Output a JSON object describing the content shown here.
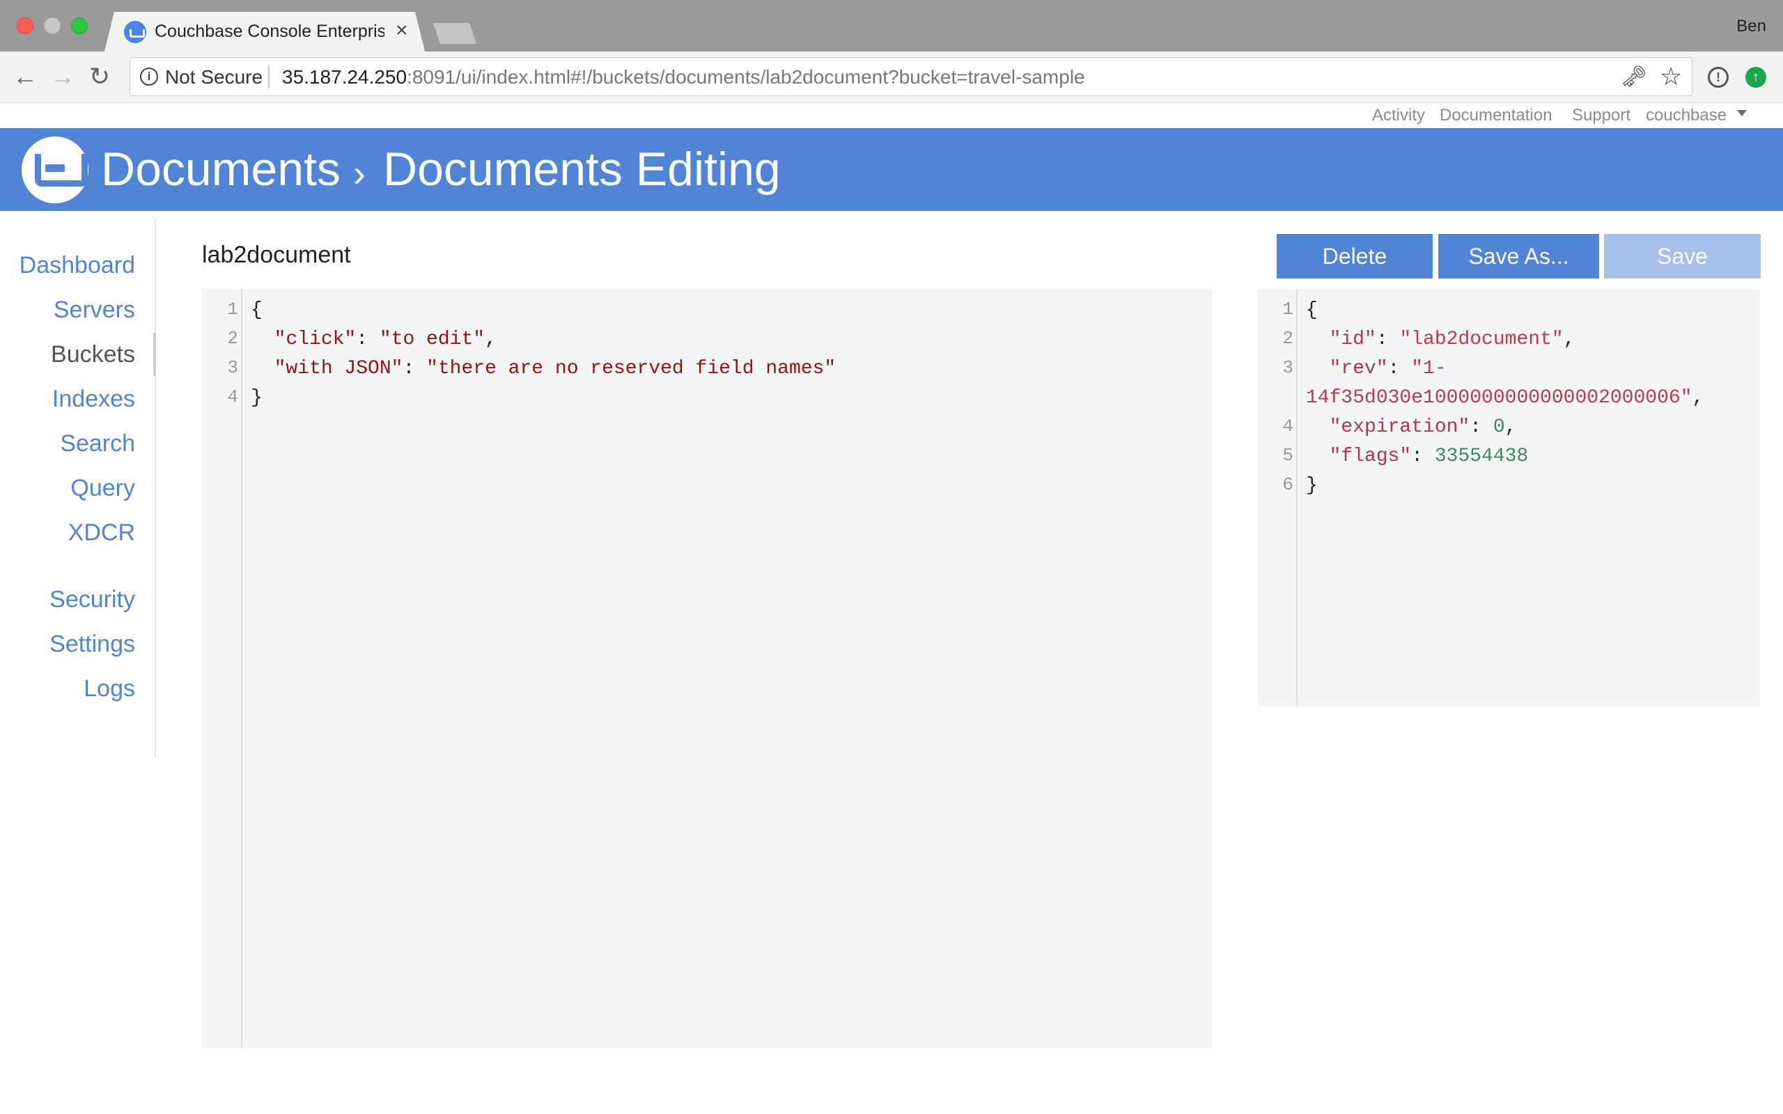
{
  "browser": {
    "tab_title": "Couchbase Console Enterprise Edition",
    "tab_close": "×",
    "profile_name": "Ben",
    "security_label": "Not Secure",
    "url_host": "35.187.24.250",
    "url_rest": ":8091/ui/index.html#!/buckets/documents/lab2document?bucket=travel-sample",
    "icons": [
      "back-arrow-icon",
      "forward-arrow-icon",
      "reload-icon",
      "info-icon",
      "key-icon",
      "star-icon",
      "extension-icon",
      "update-icon"
    ]
  },
  "util_links": {
    "activity": "Activity",
    "documentation": "Documentation",
    "support": "Support",
    "user": "couchbase"
  },
  "header": {
    "title": "Documents",
    "subtitle": "Documents Editing",
    "background": "#4f84d6"
  },
  "sidebar": {
    "items": [
      {
        "label": "Dashboard"
      },
      {
        "label": "Servers"
      },
      {
        "label": "Buckets",
        "active": true
      },
      {
        "label": "Indexes"
      },
      {
        "label": "Search"
      },
      {
        "label": "Query"
      },
      {
        "label": "XDCR"
      },
      {
        "label": "Security"
      },
      {
        "label": "Settings"
      },
      {
        "label": "Logs"
      }
    ]
  },
  "document": {
    "id": "lab2document",
    "actions": {
      "delete": "Delete",
      "save_as": "Save As...",
      "save": "Save"
    },
    "editor": {
      "line_numbers": [
        "1",
        "2",
        "3",
        "4"
      ],
      "open_brace": "{",
      "close_brace": "}",
      "fields": [
        {
          "key": "\"click\"",
          "value": "\"to edit\"",
          "trailing": ","
        },
        {
          "key": "\"with JSON\"",
          "value": "\"there are no reserved field names\"",
          "trailing": ""
        }
      ]
    },
    "metadata": {
      "line_numbers": [
        "1",
        "2",
        "3",
        "",
        "4",
        "5",
        "6"
      ],
      "open_brace": "{",
      "close_brace": "}",
      "id_key": "\"id\"",
      "id_value": "\"lab2document\"",
      "rev_key": "\"rev\"",
      "rev_value_part1": "\"1-",
      "rev_value_part2": "14f35d030e1000000000000002000006\"",
      "expiration_key": "\"expiration\"",
      "expiration_value": "0",
      "flags_key": "\"flags\"",
      "flags_value": "33554438"
    }
  },
  "colors": {
    "accent": "#4f84d6",
    "save_disabled": "#a5c1ea",
    "editor_bg": "#f4f5f7"
  }
}
